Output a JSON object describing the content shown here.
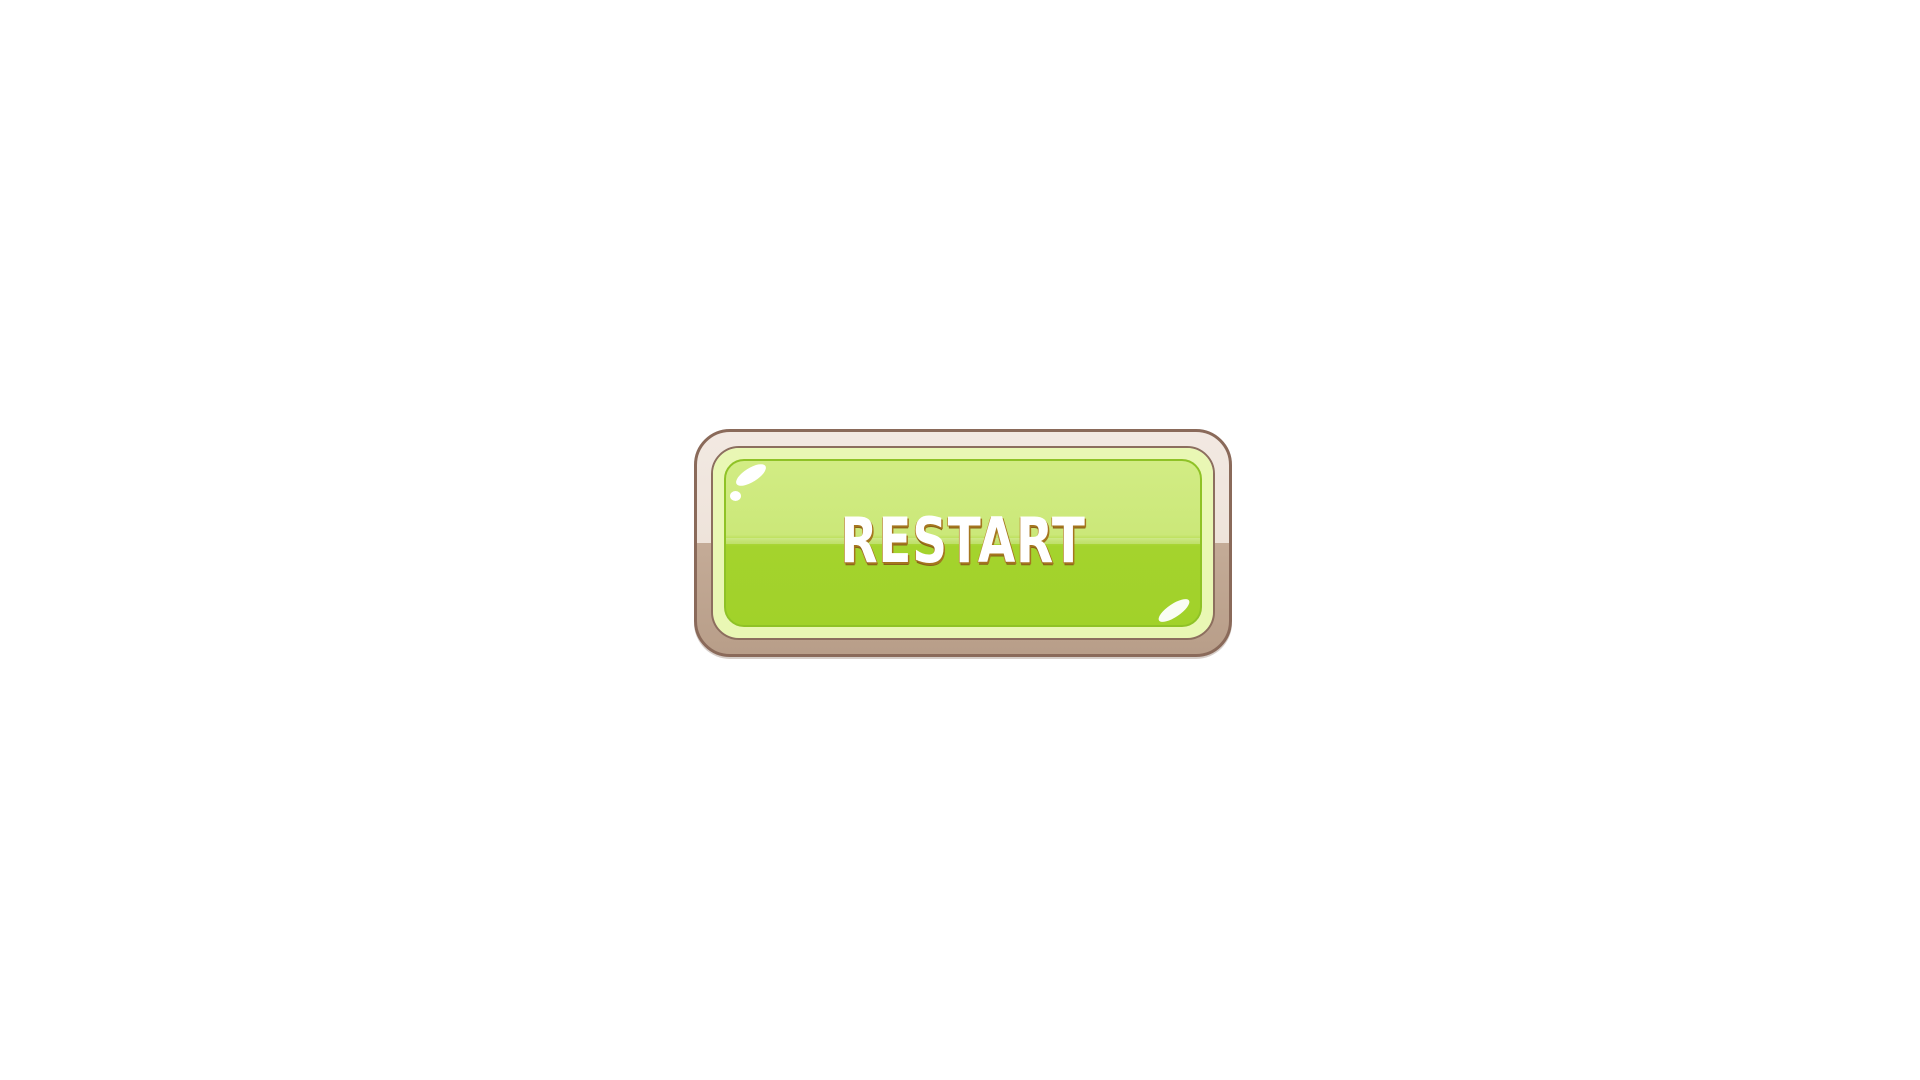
{
  "button": {
    "label": "RESTART"
  },
  "colors": {
    "background": "#ffffff",
    "frame": "#eee3da",
    "frame_shadow": "#c4ab97",
    "face_top": "#d2ec84",
    "face_bottom": "#a1d22a",
    "text": "#ffffff",
    "text_outline": "#a5761f"
  }
}
